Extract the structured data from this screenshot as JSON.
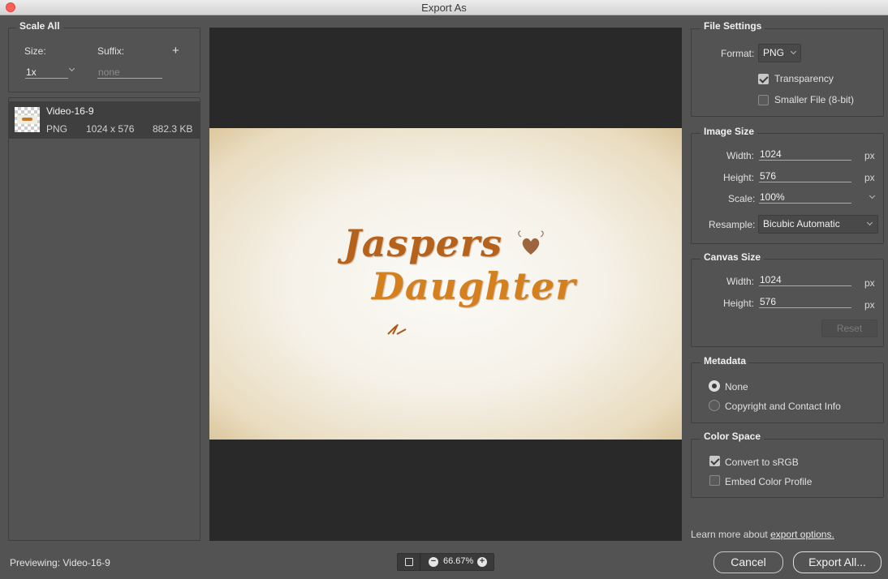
{
  "window": {
    "title": "Export As"
  },
  "scale_all": {
    "title": "Scale All",
    "size_label": "Size:",
    "suffix_label": "Suffix:",
    "add_symbol": "+",
    "size_value": "1x",
    "suffix_placeholder": "none"
  },
  "asset": {
    "name": "Video-16-9",
    "format": "PNG",
    "dimensions": "1024 x 576",
    "filesize": "882.3 KB"
  },
  "preview": {
    "line1": "Jaspers",
    "line2": "Daughter"
  },
  "file_settings": {
    "title": "File Settings",
    "format_label": "Format:",
    "format_value": "PNG",
    "transparency_label": "Transparency",
    "transparency_checked": true,
    "smaller_file_label": "Smaller File (8-bit)",
    "smaller_file_checked": false
  },
  "image_size": {
    "title": "Image Size",
    "width_label": "Width:",
    "width_value": "1024",
    "height_label": "Height:",
    "height_value": "576",
    "scale_label": "Scale:",
    "scale_value": "100%",
    "resample_label": "Resample:",
    "resample_value": "Bicubic Automatic",
    "unit": "px"
  },
  "canvas_size": {
    "title": "Canvas Size",
    "width_label": "Width:",
    "width_value": "1024",
    "height_label": "Height:",
    "height_value": "576",
    "unit": "px",
    "reset_label": "Reset"
  },
  "metadata": {
    "title": "Metadata",
    "options": [
      "None",
      "Copyright and Contact Info"
    ],
    "selected": "None"
  },
  "color_space": {
    "title": "Color Space",
    "convert_label": "Convert to sRGB",
    "convert_checked": true,
    "embed_label": "Embed Color Profile",
    "embed_checked": false
  },
  "footer": {
    "learn_more_prefix": "Learn more about",
    "learn_more_link": "export options.",
    "previewing": "Previewing: Video-16-9",
    "zoom": "66.67%",
    "cancel_label": "Cancel",
    "export_label": "Export All..."
  }
}
